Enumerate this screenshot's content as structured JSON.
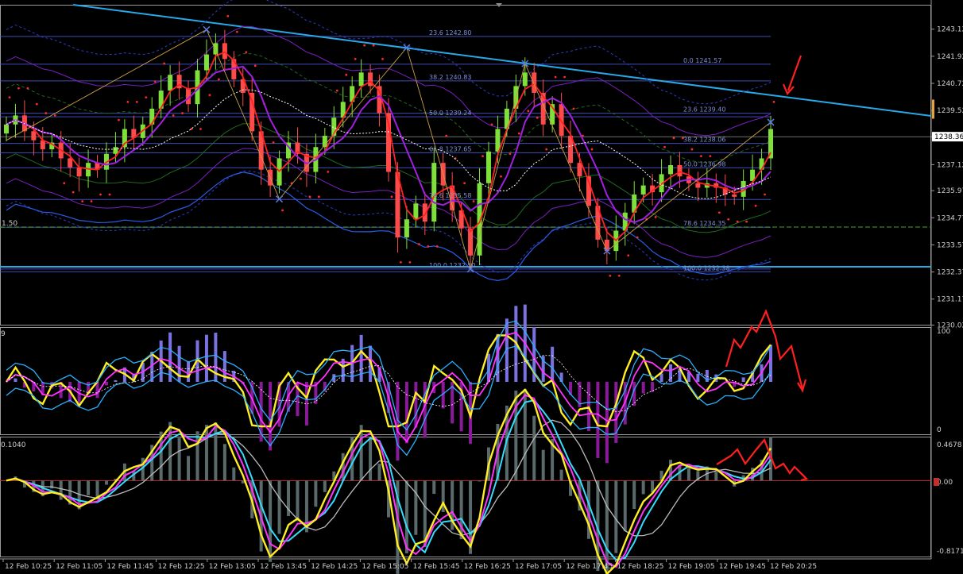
{
  "chart_data": [
    {
      "type": "candlestick",
      "panel": "price",
      "ylim": [
        1230.0,
        1244.2
      ],
      "y_ticks": [
        "1243.12",
        "1241.92",
        "1240.72",
        "1239.52",
        "1238.36",
        "1237.12",
        "1235.97",
        "1234.77",
        "1233.57",
        "1232.37",
        "1231.17",
        "1230.02"
      ],
      "current_price": "1238.36",
      "left_label": "1.50",
      "fib_levels": [
        {
          "label": "23.6 1242.80",
          "value": 1242.8
        },
        {
          "label": "38.2 1240.83",
          "value": 1240.83
        },
        {
          "label": "50.0 1239.24",
          "value": 1239.24
        },
        {
          "label": "61.8 1237.65",
          "value": 1237.65
        },
        {
          "label": "76.6 1235.58",
          "value": 1235.58
        },
        {
          "label": "100.0 1232.50",
          "value": 1232.5
        },
        {
          "label": "0.0 1241.57",
          "value": 1241.57
        },
        {
          "label": "23.6 1239.40",
          "value": 1239.4
        },
        {
          "label": "38.2 1238.06",
          "value": 1238.06
        },
        {
          "label": "50.0 1236.98",
          "value": 1236.98
        },
        {
          "label": "78.6 1234.35",
          "value": 1234.35
        },
        {
          "label": "100.0 1232.38",
          "value": 1232.38
        }
      ],
      "series": [
        {
          "name": "",
          "close": [
            1238.9,
            1239.3,
            1238.6,
            1238.2,
            1237.8,
            1238.1,
            1237.4,
            1237.0,
            1236.6,
            1237.2,
            1236.9,
            1237.6,
            1237.9,
            1238.7,
            1238.3,
            1238.9,
            1239.6,
            1240.4,
            1241.1,
            1240.5,
            1239.8,
            1241.3,
            1242.0,
            1242.5,
            1241.8,
            1240.9,
            1240.3,
            1238.6,
            1236.9,
            1236.2,
            1237.4,
            1238.1,
            1237.6,
            1236.8,
            1237.9,
            1238.4,
            1239.2,
            1239.9,
            1240.6,
            1241.2,
            1240.6,
            1239.4,
            1236.8,
            1233.9,
            1234.7,
            1235.4,
            1234.6,
            1237.2,
            1236.2,
            1235.1,
            1234.3,
            1233.1,
            1236.3,
            1237.7,
            1238.7,
            1239.6,
            1240.6,
            1241.2,
            1240.3,
            1238.9,
            1239.8,
            1238.4,
            1237.2,
            1236.6,
            1235.3,
            1233.8,
            1233.3,
            1234.2,
            1235.0,
            1235.8,
            1236.2,
            1235.9,
            1236.7,
            1237.1,
            1236.6,
            1236.3,
            1236.1,
            1236.3,
            1236.1,
            1235.8,
            1235.7,
            1236.4,
            1236.9,
            1237.4,
            1238.7
          ]
        }
      ],
      "x_ticks": [
        "12 Feb 10:25",
        "12 Feb 11:05",
        "12 Feb 11:45",
        "12 Feb 12:25",
        "12 Feb 13:05",
        "12 Feb 13:45",
        "12 Feb 14:25",
        "12 Feb 15:05",
        "12 Feb 15:45",
        "12 Feb 16:25",
        "12 Feb 17:05",
        "12 Feb 17:45",
        "12 Feb 18:25",
        "12 Feb 19:05",
        "12 Feb 19:45",
        "12 Feb 20:25"
      ]
    },
    {
      "type": "line",
      "panel": "oscillator_1",
      "label": "9",
      "ylim": [
        0,
        100
      ],
      "y_ticks": [
        "100",
        "0"
      ]
    },
    {
      "type": "line",
      "panel": "oscillator_2",
      "label": "0.1040",
      "ylim": [
        -0.8171,
        0.4678
      ],
      "y_ticks": [
        "0.4678",
        "0.00",
        "-0.8171"
      ]
    }
  ],
  "colors": {
    "background": "#000000",
    "bull": "#7fe03a",
    "bear": "#ff4a4a",
    "trend": "#29a8e8",
    "fib": "#4b5bd6",
    "annotation": "#ff1f1f",
    "yellow": "#ffee22",
    "magenta": "#ff33ff",
    "cyan": "#33ddff"
  }
}
